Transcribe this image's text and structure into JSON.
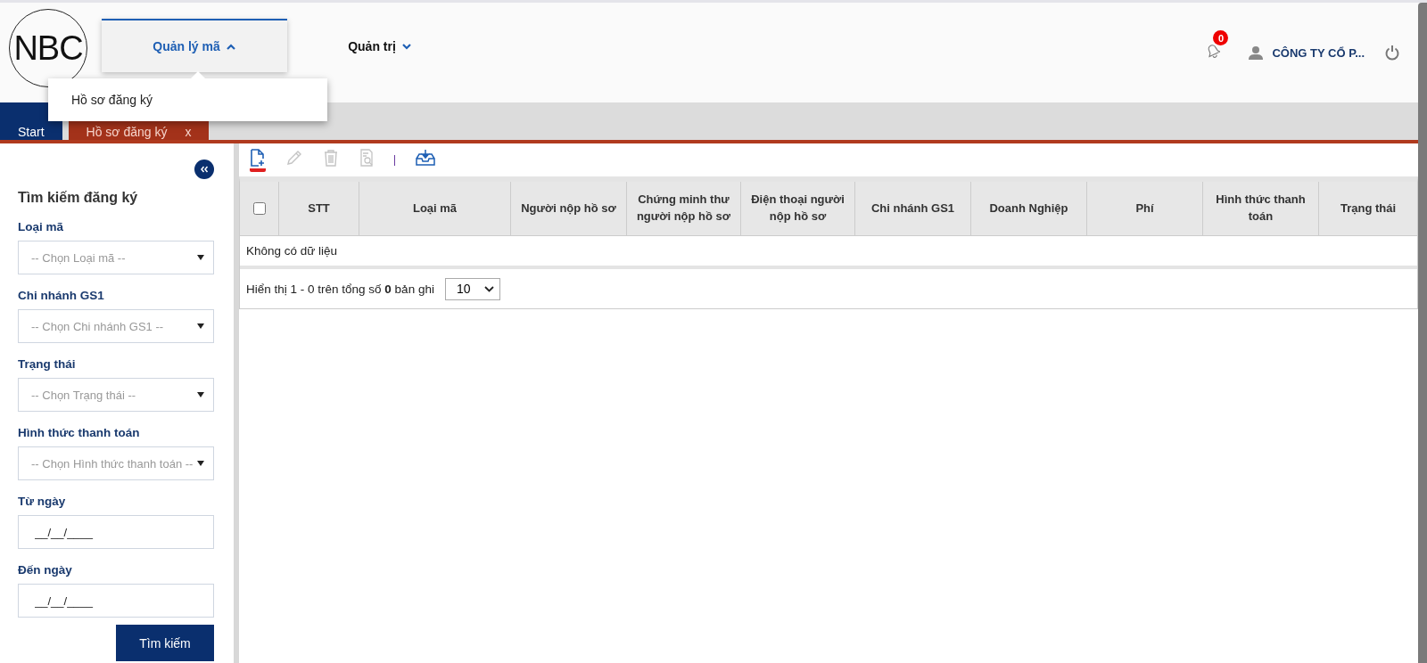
{
  "header": {
    "logo": "NBC",
    "nav": [
      {
        "label": "Quản lý mã",
        "selected": true,
        "expanded": true
      },
      {
        "label": "Quản trị",
        "selected": false,
        "expanded": false
      }
    ],
    "nav_menu": [
      "Hồ sơ đăng ký"
    ],
    "notifications": {
      "count": "0"
    },
    "user": "CÔNG TY CỔ P..."
  },
  "tabs": [
    {
      "label": "Start",
      "selected": false,
      "closable": false
    },
    {
      "label": "Hồ sơ đăng ký",
      "selected": true,
      "closable": true,
      "close": "x"
    }
  ],
  "sidebar": {
    "title": "Tìm kiếm đăng ký",
    "filters": [
      {
        "label": "Loại mã",
        "kind": "select",
        "placeholder": "-- Chọn Loại mã --"
      },
      {
        "label": "Chi nhánh GS1",
        "kind": "select",
        "placeholder": "-- Chọn Chi nhánh GS1 --"
      },
      {
        "label": "Trạng thái",
        "kind": "select",
        "placeholder": "-- Chọn Trạng thái --"
      },
      {
        "label": "Hình thức thanh toán",
        "kind": "select",
        "placeholder": "-- Chọn Hình thức thanh toán --"
      },
      {
        "label": "Từ ngày",
        "kind": "date",
        "placeholder": "__/__/____"
      },
      {
        "label": "Đến ngày",
        "kind": "date",
        "placeholder": "__/__/____"
      }
    ],
    "search_button": "Tìm kiếm"
  },
  "toolbar": [
    {
      "kind": "add",
      "disabled": false,
      "selected": true
    },
    {
      "kind": "edit",
      "disabled": true,
      "selected": false
    },
    {
      "kind": "delete",
      "disabled": true,
      "selected": false
    },
    {
      "kind": "view",
      "disabled": true,
      "selected": false
    },
    {
      "kind": "separator"
    },
    {
      "kind": "import",
      "disabled": false,
      "selected": false
    }
  ],
  "table": {
    "select_all": {
      "checked": false
    },
    "columns": [
      "STT",
      "Loại mã",
      "Người nộp hồ sơ",
      "Chứng minh thư người nộp hồ sơ",
      "Điện thoại người nộp hồ sơ",
      "Chi nhánh GS1",
      "Doanh Nghiệp",
      "Phí",
      "Hình thức thanh toán",
      "Trạng thái"
    ],
    "empty": "Không có dữ liệu"
  },
  "pager": {
    "summary": "Hiển thị 1 - 0 trên tổng số **0** bản ghi",
    "page_size": "10"
  }
}
